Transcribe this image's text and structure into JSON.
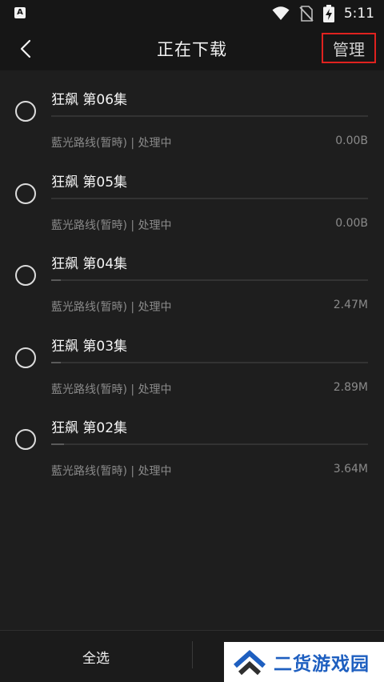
{
  "status_bar": {
    "time": "5:11",
    "icons": [
      "notification-a-icon",
      "wifi-icon",
      "no-sim-icon",
      "battery-charging-icon"
    ]
  },
  "header": {
    "title": "正在下载",
    "manage_label": "管理"
  },
  "downloads": [
    {
      "title": "狂飙 第06集",
      "subtitle": "藍光路线(暂時) | 处理中",
      "size": "0.00B",
      "progress": 0.0
    },
    {
      "title": "狂飙 第05集",
      "subtitle": "藍光路线(暂時) | 处理中",
      "size": "0.00B",
      "progress": 0.0
    },
    {
      "title": "狂飙 第04集",
      "subtitle": "藍光路线(暂時) | 处理中",
      "size": "2.47M",
      "progress": 0.03
    },
    {
      "title": "狂飙 第03集",
      "subtitle": "藍光路线(暂時) | 处理中",
      "size": "2.89M",
      "progress": 0.03
    },
    {
      "title": "狂飙 第02集",
      "subtitle": "藍光路线(暂時) | 处理中",
      "size": "3.64M",
      "progress": 0.04
    }
  ],
  "bottom_bar": {
    "select_all_label": "全选"
  },
  "watermark": {
    "text": "二货游戏园"
  },
  "colors": {
    "background": "#1e1e1e",
    "header": "#161616",
    "manage_border": "#e0221f",
    "watermark_blue": "#1e5fc0"
  }
}
